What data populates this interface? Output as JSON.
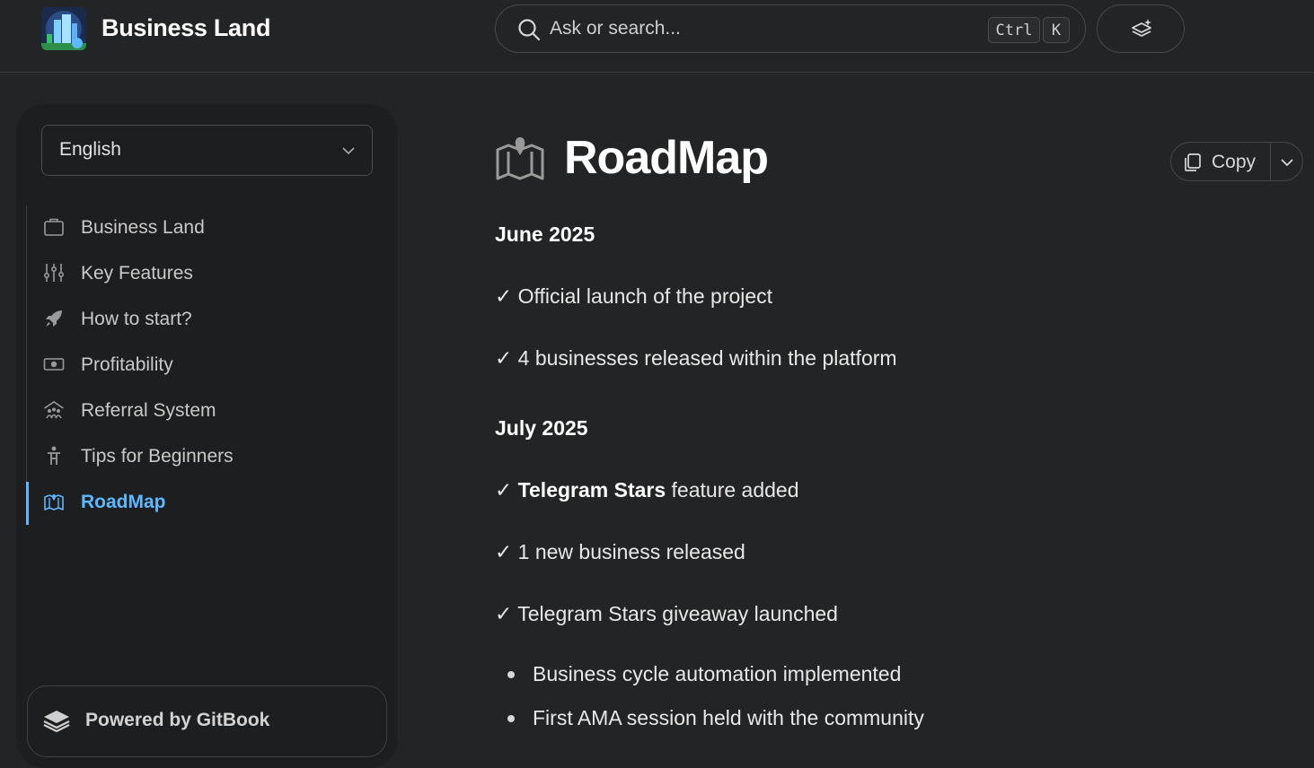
{
  "header": {
    "brand": "Business Land",
    "search_placeholder": "Ask or search...",
    "shortcut_ctrl": "Ctrl",
    "shortcut_key": "K"
  },
  "sidebar": {
    "language": "English",
    "items": [
      {
        "label": "Business Land",
        "icon": "briefcase-icon"
      },
      {
        "label": "Key Features",
        "icon": "sliders-icon"
      },
      {
        "label": "How to start?",
        "icon": "rocket-icon"
      },
      {
        "label": "Profitability",
        "icon": "money-icon"
      },
      {
        "label": "Referral System",
        "icon": "people-roof-icon"
      },
      {
        "label": "Tips for Beginners",
        "icon": "person-icon"
      },
      {
        "label": "RoadMap",
        "icon": "map-icon",
        "active": true
      }
    ],
    "powered_by": "Powered by GitBook"
  },
  "page": {
    "title": "RoadMap",
    "copy_label": "Copy",
    "sections": [
      {
        "heading": "June 2025",
        "items": [
          "✓ Official launch of the project",
          "✓ 4 businesses released within the platform"
        ]
      },
      {
        "heading": "July 2025",
        "items_rich": [
          {
            "check": "✓ ",
            "bold": "Telegram Stars",
            "rest": " feature added"
          },
          {
            "check": "✓ ",
            "bold": "",
            "rest": "1 new business released"
          },
          {
            "check": "✓ ",
            "bold": "",
            "rest": "Telegram Stars giveaway launched"
          }
        ],
        "bullets": [
          "Business cycle automation implemented",
          "First AMA session held with the community"
        ]
      }
    ]
  },
  "colors": {
    "background": "#232425",
    "sidebar": "#1d1e1f",
    "accent": "#5cb8ff"
  }
}
